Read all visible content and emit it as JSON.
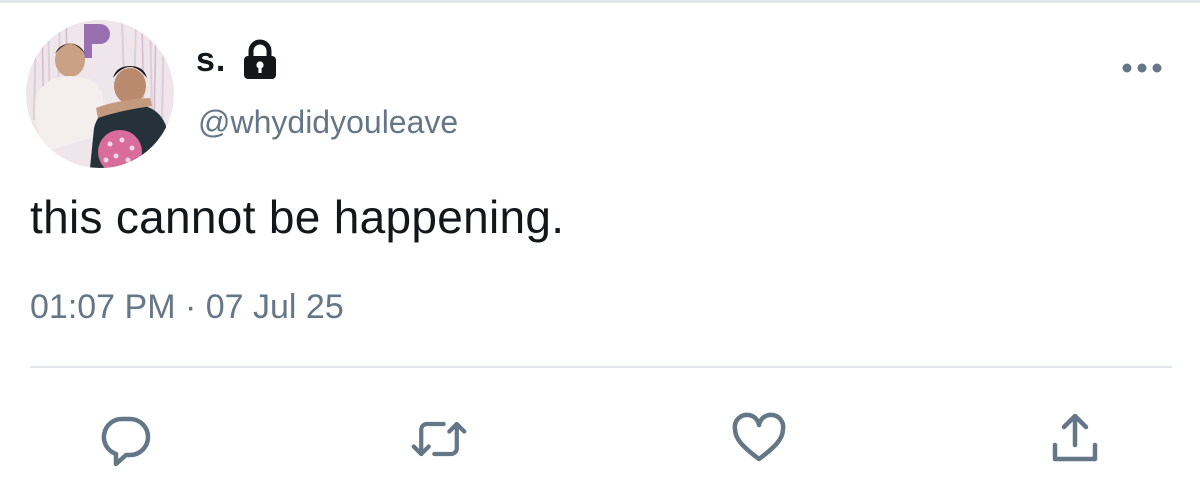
{
  "tweet": {
    "display_name": "s.",
    "handle": "@whydidyouleave",
    "protected": true,
    "text": "this cannot be happening.",
    "timestamp": "01:07 PM · 07 Jul 25"
  },
  "icons": {
    "lock": "lock-icon",
    "more": "more-options-icon",
    "reply": "reply-icon",
    "retweet": "retweet-icon",
    "like": "like-icon",
    "share": "share-icon"
  },
  "colors": {
    "text": "#14171a",
    "secondary": "#657786",
    "icon": "#657786",
    "divider": "#e1e8ed"
  }
}
